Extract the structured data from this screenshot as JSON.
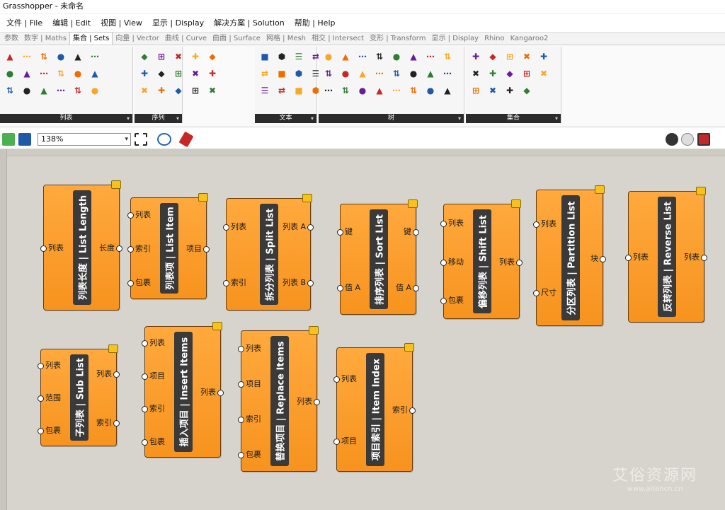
{
  "app": {
    "title": "Grasshopper - 未命名"
  },
  "menu": [
    "文件 | File",
    "编辑 | Edit",
    "视图 | View",
    "显示 | Display",
    "解决方案 | Solution",
    "帮助 | Help"
  ],
  "tabs": [
    {
      "label": "参数",
      "active": false
    },
    {
      "label": "数字 | Maths",
      "active": false
    },
    {
      "label": "集合 | Sets",
      "active": true
    },
    {
      "label": "向量 | Vector",
      "active": false
    },
    {
      "label": "曲线 | Curve",
      "active": false
    },
    {
      "label": "曲面 | Surface",
      "active": false
    },
    {
      "label": "网格 | Mesh",
      "active": false
    },
    {
      "label": "相交 | Intersect",
      "active": false
    },
    {
      "label": "变形 | Transform",
      "active": false
    },
    {
      "label": "显示 | Display",
      "active": false
    },
    {
      "label": "Rhino",
      "active": false
    },
    {
      "label": "Kangaroo2",
      "active": false
    }
  ],
  "ribbon": {
    "panels": [
      {
        "title": "列表",
        "icons": [
          "list-length-icon",
          "insert-items-icon",
          "replace-items-icon",
          "sort-list-icon",
          "shift-list-icon",
          "split-list-icon",
          "sub-list-icon",
          "reverse-list-icon",
          "item-index-icon",
          "partition-list-icon",
          "dispatch-icon",
          "weave-icon",
          "cull-icon",
          "pick-icon",
          "null-item-icon",
          "list-item-icon",
          "sift-icon",
          "combine-data-icon"
        ]
      },
      {
        "title": "序列",
        "icons": [
          "series-icon",
          "range-icon",
          "random-icon",
          "repeat-icon",
          "cull-nth-icon",
          "cull-pattern-icon",
          "duplicate-icon",
          "fibonacci-icon",
          "jitter-icon",
          "stack-icon",
          "char-seq-icon",
          "spiral-icon",
          "sequence-icon",
          "graph-icon",
          "box-icon"
        ]
      },
      {
        "title": "文本",
        "icons": [
          "text-icon",
          "concat-icon",
          "fragment-icon",
          "join-icon",
          "replace-text-icon",
          "case-icon",
          "format-icon",
          "split-text-icon",
          "sort-text-icon",
          "match-icon",
          "trim-icon",
          "len-icon"
        ]
      },
      {
        "title": "树",
        "icons": [
          "graft-icon",
          "flatten-icon",
          "simplify-icon",
          "explode-tree-icon",
          "merge-icon",
          "clean-icon",
          "entwine-icon",
          "path-icon",
          "prune-icon",
          "trim-tree-icon",
          "split-tree-icon",
          "match-tree-icon",
          "stream-icon",
          "branch-icon",
          "tree-stats-icon",
          "unflatten-icon",
          "relative-icon",
          "shift-paths-icon",
          "tree-item-icon",
          "tree-branch-icon",
          "param-viewer-icon",
          "gate-icon",
          "filter-icon",
          "clean-tree-icon"
        ]
      },
      {
        "title": "集合",
        "icons": [
          "create-set-icon",
          "set-union-icon",
          "set-intersect-icon",
          "set-difference-icon",
          "member-index-icon",
          "replace-members-icon",
          "key-value-icon",
          "set-majority-icon",
          "find-similar-icon",
          "disjoint-icon",
          "combinations-icon",
          "permutations-icon",
          "carthesian-icon",
          "delete-icon"
        ]
      }
    ]
  },
  "toolbar": {
    "zoom": "138%"
  },
  "components": [
    {
      "title": "列表长度 | List Length",
      "inputs": [
        "列表"
      ],
      "outputs": [
        "长度"
      ]
    },
    {
      "title": "列表项 | List Item",
      "inputs": [
        "列表",
        "索引",
        "包裹"
      ],
      "outputs": [
        "项目"
      ]
    },
    {
      "title": "拆分列表 | Split List",
      "inputs": [
        "列表",
        "索引"
      ],
      "outputs": [
        "列表 A",
        "列表 B"
      ]
    },
    {
      "title": "排序列表 | Sort List",
      "inputs": [
        "键",
        "值 A"
      ],
      "outputs": [
        "键",
        "值 A"
      ]
    },
    {
      "title": "偏移列表 | Shift List",
      "inputs": [
        "列表",
        "移动",
        "包裹"
      ],
      "outputs": [
        "列表"
      ]
    },
    {
      "title": "分区列表 | Partition List",
      "inputs": [
        "列表",
        "尺寸"
      ],
      "outputs": [
        "块"
      ]
    },
    {
      "title": "反转列表 | Reverse List",
      "inputs": [
        "列表"
      ],
      "outputs": [
        "列表"
      ]
    },
    {
      "title": "子列表 | Sub List",
      "inputs": [
        "列表",
        "范围",
        "包裹"
      ],
      "outputs": [
        "列表",
        "索引"
      ]
    },
    {
      "title": "插入项目 | Insert Items",
      "inputs": [
        "列表",
        "项目",
        "索引",
        "包裹"
      ],
      "outputs": [
        "列表"
      ]
    },
    {
      "title": "替换项目 | Replace Items",
      "inputs": [
        "列表",
        "项目",
        "索引",
        "包裹"
      ],
      "outputs": [
        "列表"
      ]
    },
    {
      "title": "项目索引 | Item Index",
      "inputs": [
        "列表",
        "项目"
      ],
      "outputs": [
        "索引"
      ]
    }
  ],
  "watermark": {
    "line1": "艾俗资源网",
    "line2": "www.aitencn.cn"
  }
}
